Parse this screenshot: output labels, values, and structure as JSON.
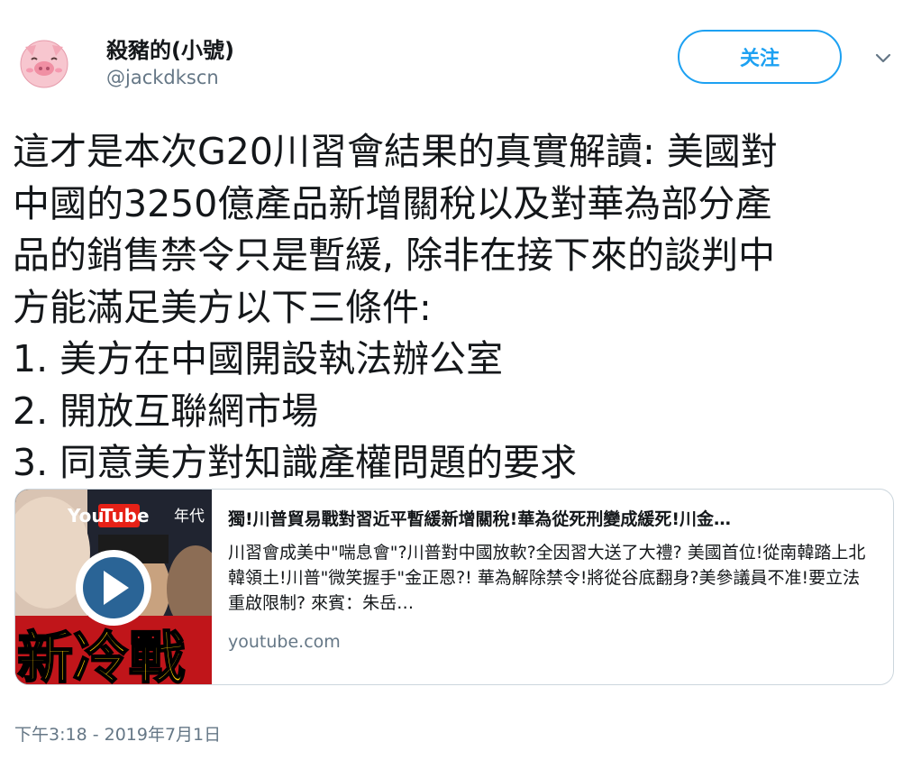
{
  "header": {
    "display_name": "殺豬的(小號)",
    "handle": "@jackdkscn",
    "follow_label": "关注"
  },
  "tweet": {
    "lines": [
      "這才是本次G20川習會結果的真實解讀: 美國對",
      "中國的3250億產品新增關稅以及對華為部分產",
      "品的銷售禁令只是暫緩, 除非在接下來的談判中",
      "方能滿足美方以下三條件:",
      "1. 美方在中國開設執法辦公室",
      "2. 開放互聯網市場",
      "3. 同意美方對知識產權問題的要求"
    ],
    "timestamp": "下午3:18 - 2019年7月1日"
  },
  "card": {
    "title": "獨!川普貿易戰對習近平暫緩新增關稅!華為從死刑變成緩死!川金…",
    "description": "川習會成美中\"喘息會\"?川普對中國放軟?全因習大送了大禮? 美國首位!從南韓踏上北韓領土!川普\"微笑握手\"金正恩?! 華為解除禁令!將從谷底翻身?美參議員不准!要立法重啟限制? 來賓：朱岳…",
    "domain": "youtube.com",
    "thumbnail": {
      "youtube_you": "You",
      "youtube_tube": "Tube",
      "channel_text": "年代",
      "overlay_text": "新冷戰"
    }
  },
  "colors": {
    "accent": "#1da1f2",
    "secondary_text": "#657786",
    "border": "#ccd6dd",
    "thumb_text": "#f5c400"
  },
  "icons": {
    "avatar": "pig-face-icon",
    "dropdown": "chevron-down-icon",
    "play": "play-icon"
  }
}
